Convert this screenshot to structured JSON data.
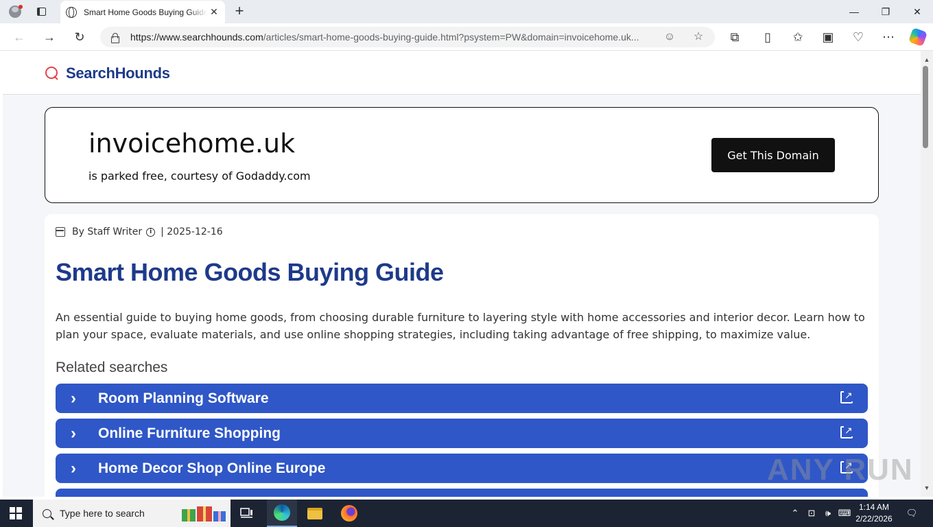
{
  "browser": {
    "tab_title": "Smart Home Goods Buying Guide",
    "url_domain": "https://www.searchhounds.com",
    "url_path": "/articles/smart-home-goods-buying-guide.html?psystem=PW&domain=invoicehome.uk...",
    "win_min": "—",
    "win_restore": "❐",
    "win_close": "✕",
    "tab_close": "✕",
    "new_tab": "+"
  },
  "site": {
    "brand": "SearchHounds"
  },
  "domain_card": {
    "domain": "invoicehome.uk",
    "parked_text": "is parked free, courtesy of Godaddy.com",
    "button": "Get This Domain"
  },
  "article": {
    "author": "By Staff Writer",
    "date": "| 2025-12-16",
    "title": "Smart Home Goods Buying Guide",
    "description": "An essential guide to buying home goods, from choosing durable furniture to layering style with home accessories and interior decor. Learn how to plan your space, evaluate materials, and use online shopping strategies, including taking advantage of free shipping, to maximize value.",
    "related_heading": "Related searches",
    "related": [
      {
        "label": "Room Planning Software"
      },
      {
        "label": "Online Furniture Shopping"
      },
      {
        "label": "Home Decor Shop Online Europe"
      }
    ]
  },
  "watermark": "ANY RUN",
  "taskbar": {
    "search_placeholder": "Type here to search",
    "time": "1:14 AM",
    "date": "2/22/2026"
  },
  "colors": {
    "brand_blue": "#1e3a8a",
    "related_bg": "#2f57c7",
    "logo_red": "#e8414a"
  }
}
